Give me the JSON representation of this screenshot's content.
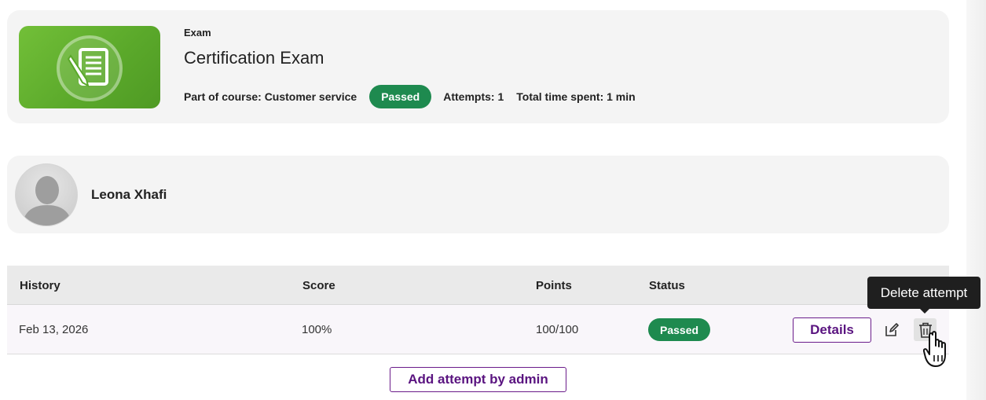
{
  "exam": {
    "type_label": "Exam",
    "title": "Certification Exam",
    "course_label": "Part of course: Customer service",
    "status": "Passed",
    "attempts_label": "Attempts: 1",
    "time_label": "Total time spent: 1 min",
    "thumbnail_icon": "exam-document-pen-icon"
  },
  "user": {
    "name": "Leona Xhafi",
    "avatar_icon": "default-user-avatar"
  },
  "table": {
    "headers": [
      "History",
      "Score",
      "Points",
      "Status"
    ],
    "rows": [
      {
        "date": "Feb 13, 2026",
        "score": "100%",
        "points": "100/100",
        "status": "Passed",
        "details_label": "Details",
        "edit_icon": "edit-icon",
        "delete_icon": "trash-icon"
      }
    ]
  },
  "actions": {
    "add_attempt_label": "Add attempt by admin"
  },
  "tooltip": {
    "text": "Delete attempt"
  },
  "colors": {
    "accent_purple": "#5a1480",
    "passed_green": "#1e8a4f",
    "thumbnail_green": "#6ab632"
  }
}
